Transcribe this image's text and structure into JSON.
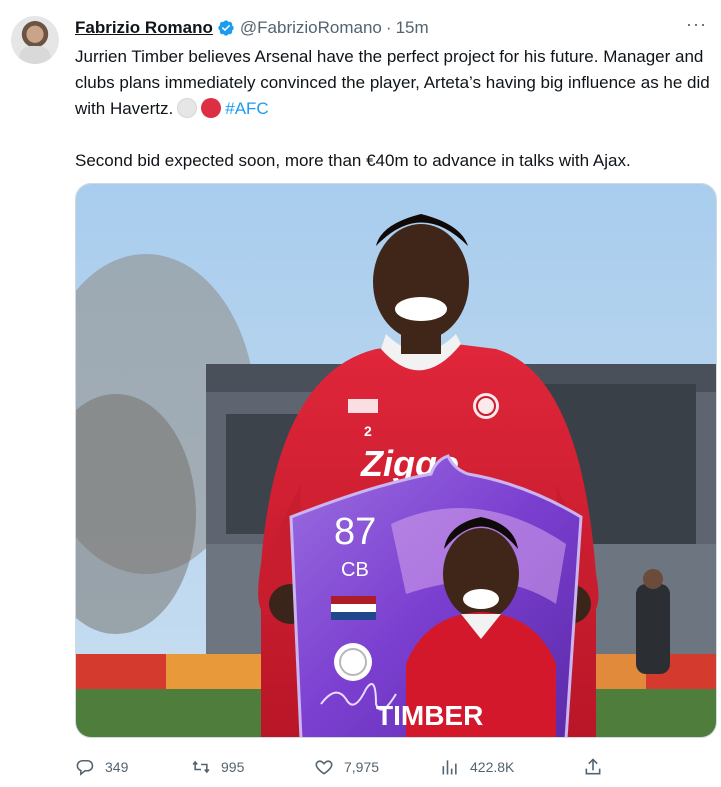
{
  "author": {
    "name": "Fabrizio Romano",
    "handle": "@FabrizioRomano",
    "separator": "·",
    "time": "15m"
  },
  "more_label": "···",
  "tweet": {
    "line1": "Jurrien Timber believes Arsenal have the perfect project for his future. Manager and clubs plans immediately convinced the player, Arteta’s having big influence as he did with Havertz.",
    "hashtag": "#AFC",
    "line2": "Second bid expected soon, more than €40m to advance in talks with Ajax."
  },
  "media": {
    "card_rating": "87",
    "card_position": "CB",
    "card_name": "TIMBER",
    "shirt_number": "2",
    "shirt_sponsor": "Ziggo"
  },
  "actions": {
    "replies": "349",
    "retweets": "995",
    "likes": "7,975",
    "views": "422.8K"
  },
  "colors": {
    "link": "#1d9bf0",
    "verified": "#1d9bf0",
    "muted": "#536471",
    "ajax_red": "#d2122e",
    "card_purple": "#7b3fd0"
  }
}
